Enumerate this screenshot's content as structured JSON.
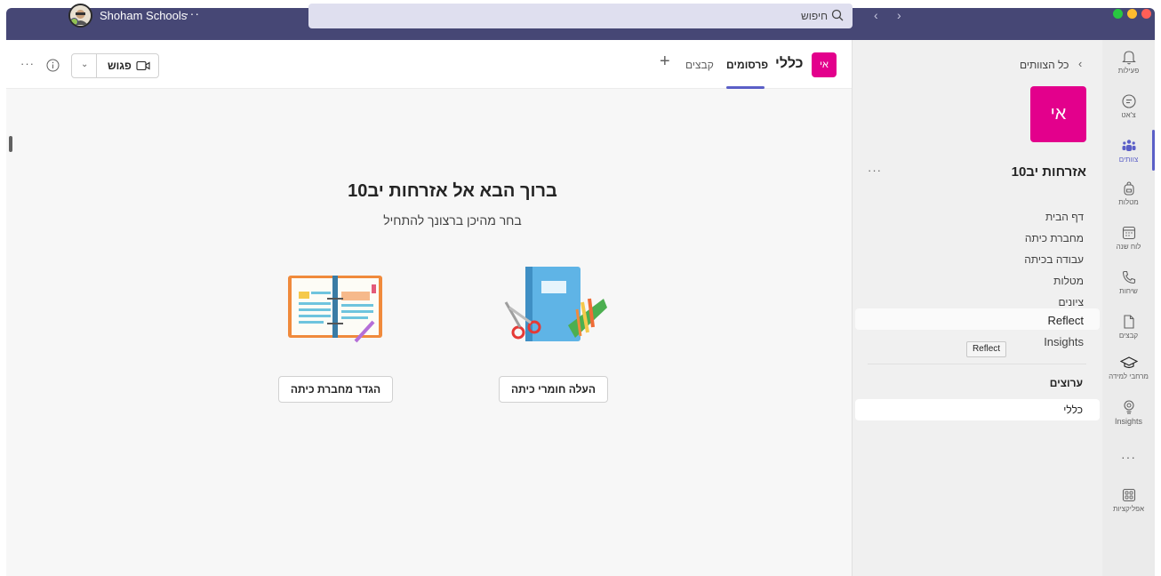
{
  "topbar": {
    "org_name": "Shoham Schools",
    "org_more": "···",
    "search_placeholder": "חיפוש",
    "nav_back": "‹",
    "nav_fwd": "›",
    "window_dots": [
      "#ffbd2e",
      "#febc2e",
      "#ff5f57"
    ]
  },
  "main": {
    "header": {
      "more": "···",
      "meet_label": "פגוש",
      "meet_chevron": "⌄",
      "channel_avatar": "אי",
      "channel_title": "כללי",
      "tabs": [
        {
          "label": "פרסומים",
          "active": true
        },
        {
          "label": "קבצים",
          "active": false
        }
      ],
      "add_tab": "+"
    },
    "welcome_title": "ברוך הבא אל אזרחות יב10",
    "welcome_subtitle": "בחר מהיכן ברצונך להתחיל",
    "actions": {
      "setup_notebook": "הגדר מחברת כיתה",
      "upload_materials": "העלה חומרי כיתה"
    }
  },
  "team_panel": {
    "all_teams": "כל הצוותים",
    "all_teams_chevron": "‹",
    "team_avatar": "אי",
    "team_name": "אזרחות יב10",
    "team_more": "···",
    "links": [
      "דף הבית",
      "מחברת כיתה",
      "עבודה בכיתה",
      "מטלות",
      "ציונים",
      "Reflect",
      "Insights"
    ],
    "tooltip": "Reflect",
    "channels_heading": "ערוצים",
    "channels": [
      "כללי"
    ]
  },
  "rail": {
    "items": [
      {
        "label": "פעילות",
        "icon": "bell-icon"
      },
      {
        "label": "צ'אט",
        "icon": "chat-icon"
      },
      {
        "label": "צוותים",
        "icon": "teams-icon",
        "active": true
      },
      {
        "label": "מטלות",
        "icon": "backpack-icon"
      },
      {
        "label": "לוח שנה",
        "icon": "calendar-icon"
      },
      {
        "label": "שיחות",
        "icon": "phone-icon"
      },
      {
        "label": "קבצים",
        "icon": "file-icon"
      },
      {
        "label": "מרחבי למידה",
        "icon": "graduation-cap-icon"
      },
      {
        "label": "Insights",
        "icon": "bulb-icon"
      }
    ],
    "more": "···",
    "apps_label": "אפליקציות"
  },
  "colors": {
    "topbar": "#464775",
    "accent": "#5b5fc7",
    "team_avatar": "#e3008c"
  }
}
